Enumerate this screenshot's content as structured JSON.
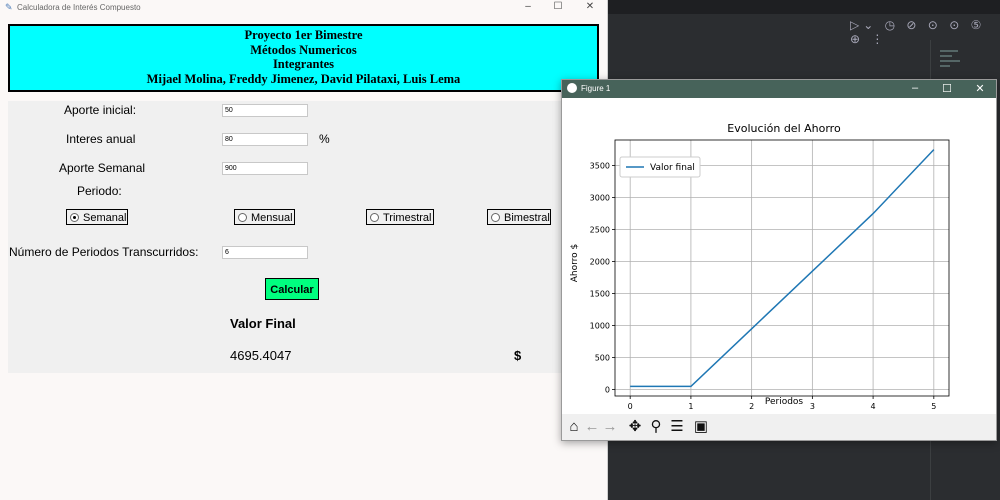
{
  "tk": {
    "title": "Calculadora de Interés Compuesto",
    "controls": {
      "minimize": "–",
      "maximize": "☐",
      "close": "✕"
    }
  },
  "header": {
    "line1": "Proyecto 1er Bimestre",
    "line2": "Métodos Numericos",
    "line3": "Integrantes",
    "line4": "Mijael Molina, Freddy Jimenez, David Pilataxi, Luis Lema"
  },
  "form": {
    "aporte_inicial_label": "Aporte inicial:",
    "aporte_inicial_value": "50",
    "interes_label": "Interes anual",
    "interes_value": "80",
    "interes_unit": "%",
    "aporte_semanal_label": "Aporte Semanal",
    "aporte_semanal_value": "900",
    "periodo_label": "Periodo:",
    "radios": [
      {
        "label": "Semanal",
        "selected": true
      },
      {
        "label": "Mensual",
        "selected": false
      },
      {
        "label": "Trimestral",
        "selected": false
      },
      {
        "label": "Bimestral",
        "selected": false
      }
    ],
    "periodos_label": "Número de Periodos Transcurridos:",
    "periodos_value": "6",
    "calc_button": "Calcular",
    "valor_final_label": "Valor Final",
    "valor_final_value": "4695.4047",
    "currency": "$"
  },
  "figure": {
    "title": "Figure 1",
    "controls": {
      "minimize": "–",
      "maximize": "☐",
      "close": "✕"
    },
    "toolbar": [
      "home-icon",
      "back-icon",
      "forward-icon",
      "pan-icon",
      "zoom-icon",
      "configure-icon",
      "save-icon"
    ]
  },
  "chart_data": {
    "type": "line",
    "title": "Evolución del Ahorro",
    "xlabel": "Periodos",
    "ylabel": "Ahorro $",
    "xlim": [
      -0.25,
      5.25
    ],
    "ylim": [
      -100,
      3900
    ],
    "x_ticks": [
      0,
      1,
      2,
      3,
      4,
      5
    ],
    "y_ticks": [
      0,
      500,
      1000,
      1500,
      2000,
      2500,
      3000,
      3500
    ],
    "grid": true,
    "legend_position": "upper-left",
    "series": [
      {
        "name": "Valor final",
        "color": "#1f77b4",
        "x": [
          0,
          1,
          2,
          3,
          4,
          5
        ],
        "y": [
          50,
          50,
          950,
          1850,
          2750,
          3750
        ]
      }
    ]
  }
}
